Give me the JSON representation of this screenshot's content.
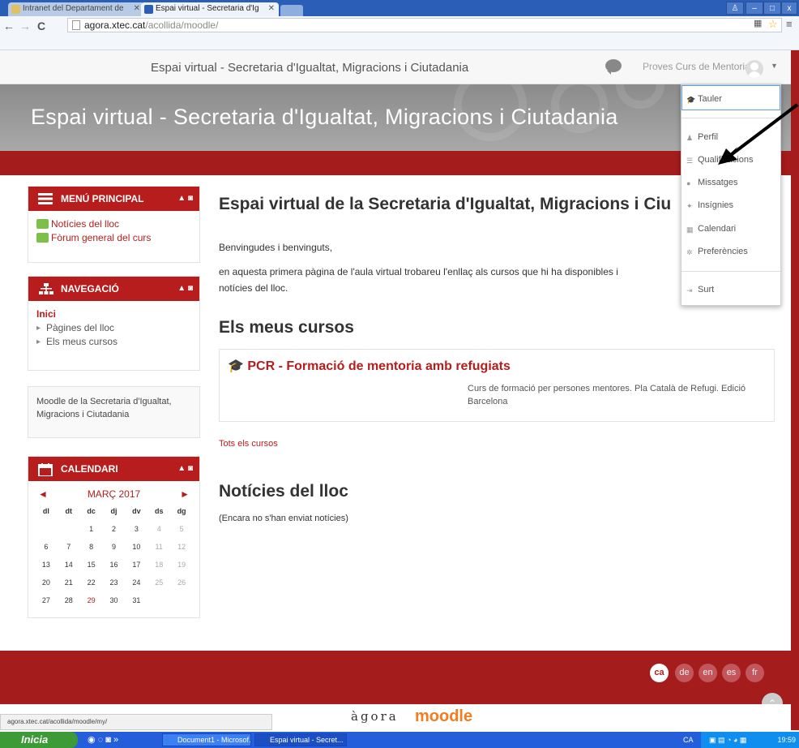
{
  "browser": {
    "tabs": [
      {
        "title": "Intranet del Departament de"
      },
      {
        "title": "Espai virtual - Secretaria d'Ig"
      }
    ],
    "url_host": "agora.xtec.cat",
    "url_path": "/acollida/moodle/"
  },
  "navbar": {
    "site_shortname": "Espai virtual - Secretaria d'Igualtat, Migracions i Ciutadania",
    "user_name": "Proves Curs de Mentoria"
  },
  "header": {
    "title": "Espai virtual - Secretaria d'Igualtat, Migracions i Ciutadania"
  },
  "user_menu": {
    "items": [
      {
        "label": "Tauler",
        "icon": "dashboard-icon"
      },
      {
        "label": "Perfil",
        "icon": "user-icon"
      },
      {
        "label": "Qualificacions",
        "icon": "grades-icon"
      },
      {
        "label": "Missatges",
        "icon": "messages-icon"
      },
      {
        "label": "Insígnies",
        "icon": "badge-icon"
      },
      {
        "label": "Calendari",
        "icon": "calendar-icon"
      },
      {
        "label": "Preferències",
        "icon": "gear-icon"
      },
      {
        "label": "Surt",
        "icon": "logout-icon"
      }
    ]
  },
  "main_menu": {
    "title": "MENÚ PRINCIPAL",
    "items": [
      "Notícies del lloc",
      "Fòrum general del curs"
    ]
  },
  "navigation": {
    "title": "NAVEGACIÓ",
    "home": "Inici",
    "items": [
      "Pàgines del lloc",
      "Els meus cursos"
    ]
  },
  "site_block": {
    "text": "Moodle de la Secretaria d'Igualtat, Migracions i Ciutadania"
  },
  "calendar": {
    "title": "CALENDARI",
    "month": "MARÇ 2017",
    "day_names": [
      "dl",
      "dt",
      "dc",
      "dj",
      "dv",
      "ds",
      "dg"
    ],
    "weeks": [
      [
        "",
        "",
        "1",
        "2",
        "3",
        "4",
        "5"
      ],
      [
        "6",
        "7",
        "8",
        "9",
        "10",
        "11",
        "12"
      ],
      [
        "13",
        "14",
        "15",
        "16",
        "17",
        "18",
        "19"
      ],
      [
        "20",
        "21",
        "22",
        "23",
        "24",
        "25",
        "26"
      ],
      [
        "27",
        "28",
        "29",
        "30",
        "31",
        "",
        ""
      ]
    ],
    "today": "29"
  },
  "main": {
    "heading": "Espai virtual de la Secretaria d'Igualtat, Migracions i Ciu",
    "greeting": "Benvingudes i benvinguts,",
    "intro_line1": "en aquesta primera pàgina de l'aula virtual trobareu l'enllaç als cursos que hi ha disponibles i",
    "intro_line2": "notícies del lloc.",
    "my_courses_heading": "Els meus cursos",
    "course_title": "PCR - Formació de mentoria amb refugiats",
    "course_summary_line1": "Curs de formació per persones mentores. Pla Català de Refugi. Edició",
    "course_summary_line2": "Barcelona",
    "all_courses_link": "Tots els cursos",
    "news_heading": "Notícies del lloc",
    "news_empty": "(Encara no s'han enviat notícies)"
  },
  "footer": {
    "languages": [
      "ca",
      "de",
      "en",
      "es",
      "fr"
    ],
    "active_language": "ca",
    "logo_agora": "àgora",
    "logo_moodle": "moodle"
  },
  "status_bar": {
    "text": "agora.xtec.cat/acollida/moodle/my/"
  },
  "taskbar": {
    "start": "Inicia",
    "tasks": [
      "Document1 - Microsof...",
      "Espai virtual - Secret..."
    ],
    "lang": "CA",
    "clock": "19:59"
  },
  "colors": {
    "accent": "#b71d1d",
    "header_gray": "#999999",
    "taskbar_blue": "#245edb"
  }
}
